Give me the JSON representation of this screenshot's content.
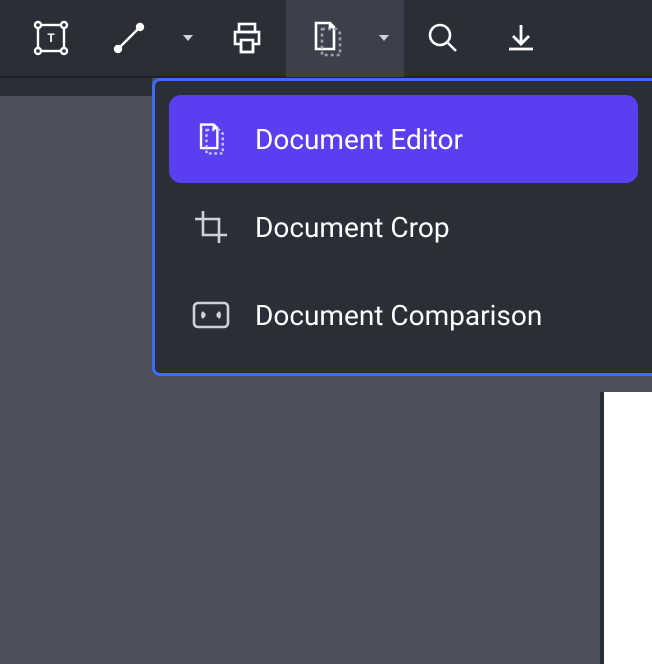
{
  "toolbar": {
    "items": [
      {
        "name": "text-frame-button",
        "icon": "text-frame-icon"
      },
      {
        "name": "line-tool-button",
        "icon": "line-icon",
        "hasDropdown": true
      },
      {
        "name": "print-button",
        "icon": "print-icon"
      },
      {
        "name": "document-tool-button",
        "icon": "document-editor-icon",
        "hasDropdown": true,
        "active": true
      },
      {
        "name": "search-button",
        "icon": "search-icon"
      },
      {
        "name": "download-button",
        "icon": "download-icon"
      }
    ]
  },
  "menu": {
    "items": [
      {
        "name": "menu-item-document-editor",
        "icon": "document-editor-icon",
        "label": "Document Editor",
        "selected": true
      },
      {
        "name": "menu-item-document-crop",
        "icon": "crop-icon",
        "label": "Document Crop",
        "selected": false
      },
      {
        "name": "menu-item-document-comparison",
        "icon": "compare-icon",
        "label": "Document Comparison",
        "selected": false
      }
    ]
  }
}
